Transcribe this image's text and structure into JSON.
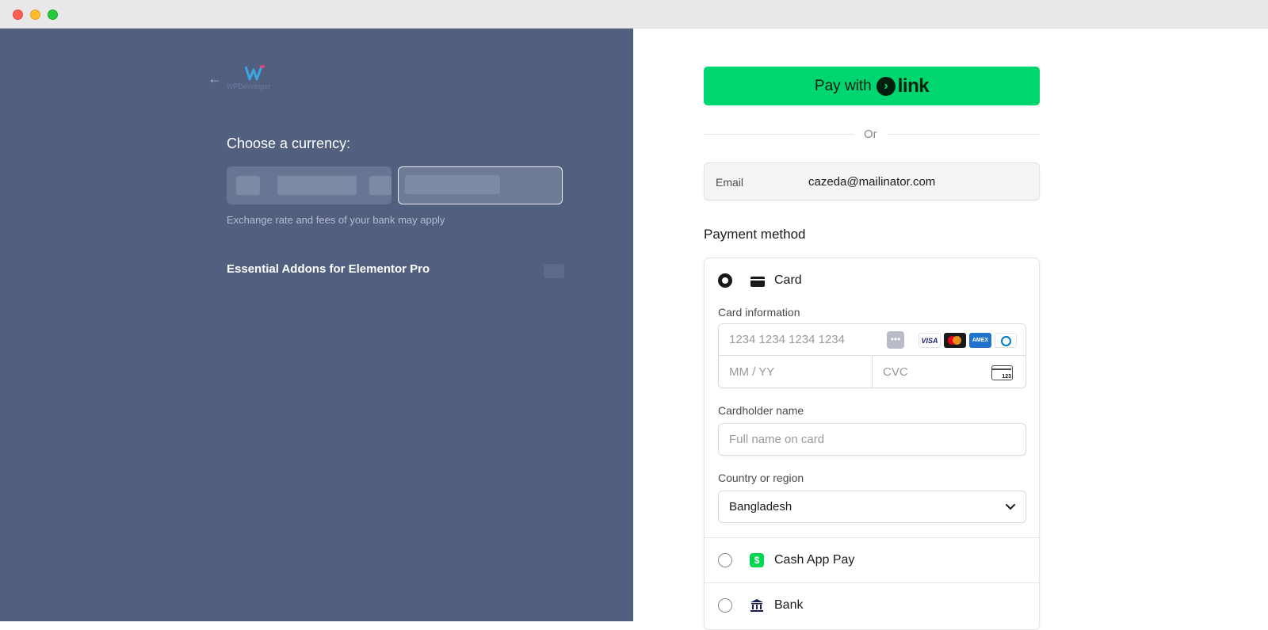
{
  "left_panel": {
    "logo_text": "WPDeveloper",
    "currency_title": "Choose a currency:",
    "exchange_note": "Exchange rate and fees of your bank may apply",
    "product_name": "Essential Addons for Elementor Pro"
  },
  "payment": {
    "pay_with_label": "Pay with",
    "link_brand": "link",
    "or_text": "Or",
    "email_label": "Email",
    "email_value": "cazeda@mailinator.com",
    "method_title": "Payment method",
    "methods": [
      {
        "label": "Card",
        "selected": true
      },
      {
        "label": "Cash App Pay",
        "selected": false
      },
      {
        "label": "Bank",
        "selected": false
      }
    ],
    "card": {
      "info_label": "Card information",
      "number_placeholder": "1234 1234 1234 1234",
      "expiry_placeholder": "MM / YY",
      "cvc_placeholder": "CVC",
      "cvc_icon_text": "123",
      "brands": [
        "VISA",
        "mastercard",
        "AMEX",
        "diners"
      ],
      "cardholder_label": "Cardholder name",
      "cardholder_placeholder": "Full name on card",
      "country_label": "Country or region",
      "country_value": "Bangladesh"
    }
  },
  "colors": {
    "left_bg": "#525f7f",
    "link_green": "#00d66f",
    "cash_green": "#00d64f"
  }
}
